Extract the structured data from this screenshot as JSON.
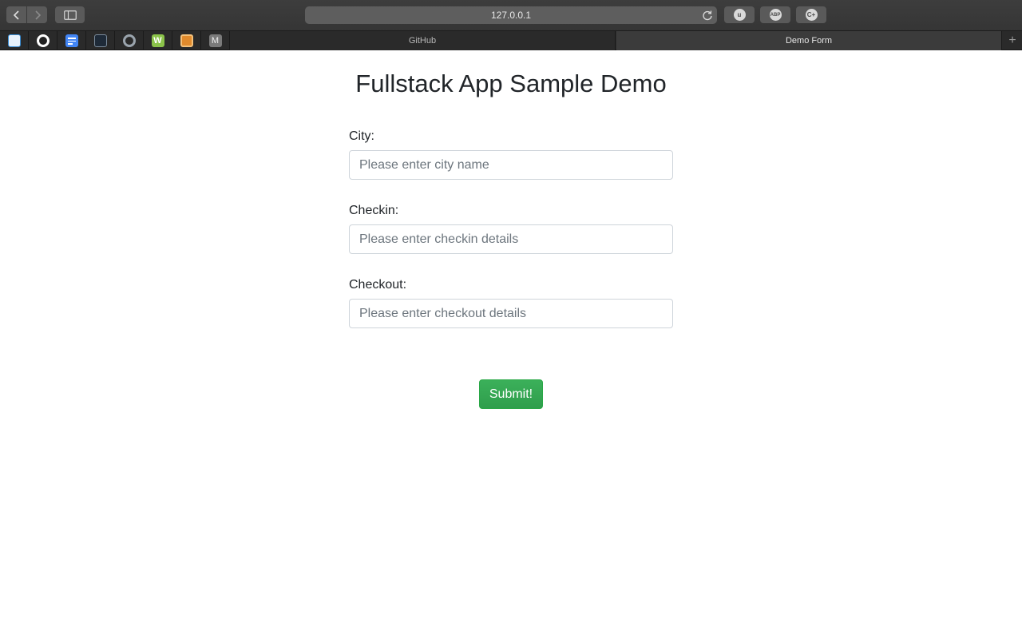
{
  "browser": {
    "address": "127.0.0.1",
    "extensions": [
      {
        "name": "ublock-icon",
        "label": "u"
      },
      {
        "name": "adblock-plus-icon",
        "label": "ABP"
      },
      {
        "name": "c-plus-icon",
        "label": "C+"
      }
    ],
    "bookmarks": [
      {
        "name": "bookmark-1",
        "color": "#3b8fd6"
      },
      {
        "name": "github-bookmark",
        "color": "#ffffff"
      },
      {
        "name": "docs-bookmark",
        "color": "#4285f4"
      },
      {
        "name": "terminal-bookmark",
        "color": "#2b4a6b"
      },
      {
        "name": "bookmark-5",
        "color": "#8a8a8a"
      },
      {
        "name": "bookmark-6",
        "color": "#8bc34a"
      },
      {
        "name": "bookmark-7",
        "color": "#e08a2c"
      },
      {
        "name": "bookmark-m",
        "color": "#7a7a7a"
      }
    ],
    "tabs": [
      {
        "label": "GitHub",
        "active": false
      },
      {
        "label": "Demo Form",
        "active": true
      }
    ]
  },
  "page": {
    "title": "Fullstack App Sample Demo",
    "fields": [
      {
        "label": "City:",
        "placeholder": "Please enter city name"
      },
      {
        "label": "Checkin:",
        "placeholder": "Please enter checkin details"
      },
      {
        "label": "Checkout:",
        "placeholder": "Please enter checkout details"
      }
    ],
    "submit_label": "Submit!"
  },
  "colors": {
    "accent": "#28a745",
    "text": "#212529"
  }
}
